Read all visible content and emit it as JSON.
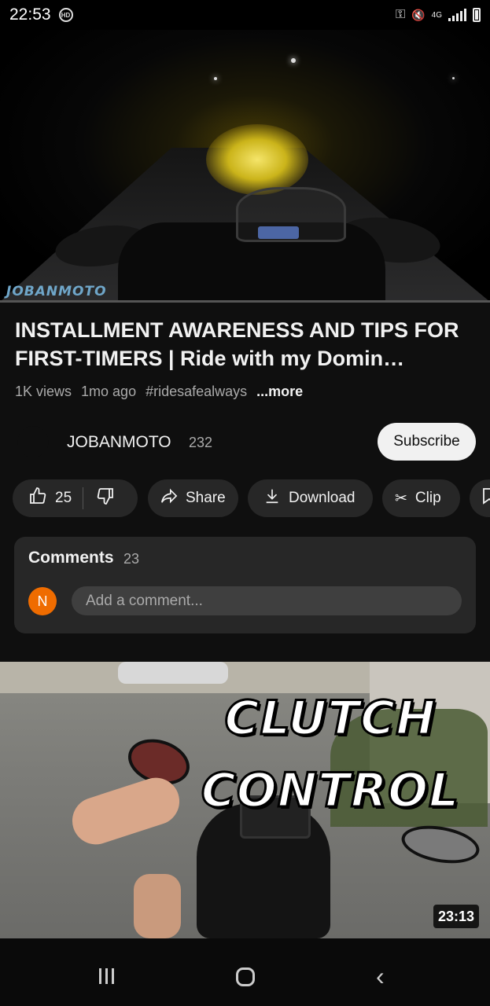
{
  "status_bar": {
    "time": "22:53",
    "hd_badge": "HD",
    "network": "4G",
    "icons": [
      "key-icon",
      "mute-icon",
      "signal-icon",
      "battery-icon"
    ]
  },
  "video": {
    "watermark": "JOBANMOTO",
    "title": "INSTALLMENT AWARENESS AND TIPS FOR FIRST-TIMERS | Ride with my Domin…",
    "views": "1K views",
    "age": "1mo ago",
    "hashtag": "#ridesafealways",
    "more_label": "...more"
  },
  "channel": {
    "name": "JOBANMOTO",
    "subscribers": "232",
    "subscribe_label": "Subscribe"
  },
  "actions": {
    "likes": "25",
    "share_label": "Share",
    "download_label": "Download",
    "clip_label": "Clip"
  },
  "comments": {
    "title": "Comments",
    "count": "23",
    "user_initial": "N",
    "placeholder": "Add a comment..."
  },
  "next_video": {
    "thumbnail_text_line1": "CLUTCH",
    "thumbnail_text_line2": "CONTROL",
    "duration": "23:13"
  },
  "colors": {
    "background": "#0f0f0f",
    "surface": "#272727",
    "avatar_orange": "#ef6c00",
    "muted_text": "#aaaaaa"
  }
}
